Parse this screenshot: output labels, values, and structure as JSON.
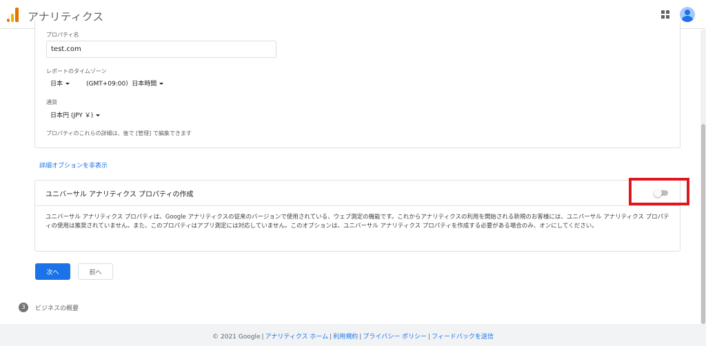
{
  "header": {
    "app_title": "アナリティクス",
    "apps_icon": "apps-grid-icon",
    "avatar_icon": "account-avatar-icon"
  },
  "property": {
    "name_label": "プロパティ名",
    "name_value": "test.com",
    "timezone_label": "レポートのタイムゾーン",
    "timezone_country": "日本",
    "timezone_value": "(GMT+09:00）日本時間",
    "currency_label": "通貨",
    "currency_value": "日本円 (JPY ￥)",
    "hint": "プロパティのこれらの詳細は、後で [管理] で編集できます"
  },
  "advanced_link": "詳細オプションを非表示",
  "universal": {
    "title": "ユニバーサル アナリティクス プロパティの作成",
    "description": "ユニバーサル アナリティクス プロパティは、Google アナリティクスの従来のバージョンで使用されている、ウェブ測定の機能です。これからアナリティクスの利用を開始される新規のお客様には、ユニバーサル アナリティクス プロパティの使用は推奨されていません。また、このプロパティはアプリ測定には対応していません。このオプションは、ユニバーサル アナリティクス プロパティを作成する必要がある場合のみ、オンにしてください。",
    "toggle_on": false
  },
  "buttons": {
    "next": "次へ",
    "prev": "前へ"
  },
  "step": {
    "number": "3",
    "label": "ビジネスの概要"
  },
  "footer": {
    "copyright": "© 2021 Google",
    "links": [
      "アナリティクス ホーム",
      "利用規約",
      "プライバシー ポリシー",
      "フィードバックを送信"
    ]
  },
  "colors": {
    "primary": "#1a73e8",
    "highlight": "#e0161f",
    "footer_bg": "#f1f3f4"
  }
}
